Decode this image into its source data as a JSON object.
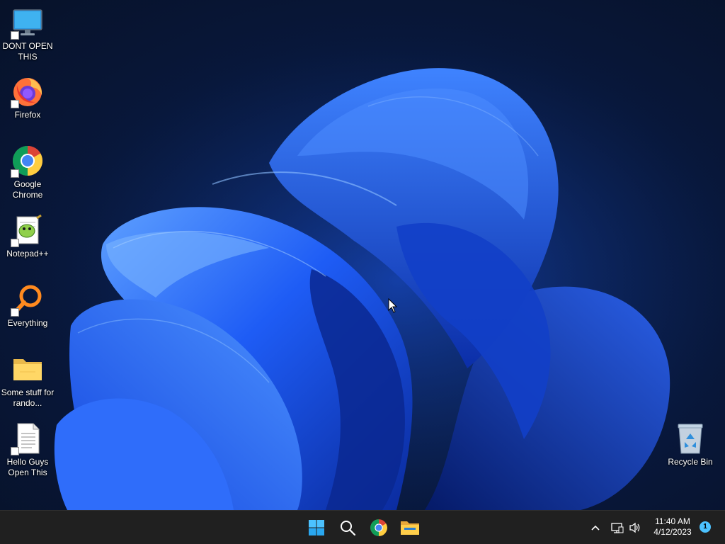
{
  "desktop": {
    "icons": [
      {
        "label": "DONT OPEN THIS",
        "icon": "monitor-icon"
      },
      {
        "label": "Firefox",
        "icon": "firefox-icon"
      },
      {
        "label": "Google Chrome",
        "icon": "chrome-icon"
      },
      {
        "label": "Notepad++",
        "icon": "notepadpp-icon"
      },
      {
        "label": "Everything",
        "icon": "search-everything-icon"
      },
      {
        "label": "Some stuff for rando...",
        "icon": "folder-icon"
      },
      {
        "label": "Hello Guys Open This",
        "icon": "text-file-icon"
      },
      {
        "label": "Recycle Bin",
        "icon": "recycle-bin-icon"
      }
    ]
  },
  "taskbar": {
    "pinned": [
      {
        "name": "Start",
        "icon": "windows-start-icon"
      },
      {
        "name": "Search",
        "icon": "search-icon"
      },
      {
        "name": "Google Chrome",
        "icon": "chrome-icon"
      },
      {
        "name": "File Explorer",
        "icon": "file-explorer-icon"
      }
    ],
    "tray": {
      "overflow_icon": "chevron-up-icon",
      "network_icon": "network-icon",
      "volume_icon": "volume-icon"
    },
    "clock": {
      "time": "11:40 AM",
      "date": "4/12/2023"
    },
    "notification_count": "1"
  },
  "colors": {
    "taskbar_bg": "#202020",
    "wallpaper_accent": "#1a5cff",
    "notification_badge": "#4cc2ff"
  }
}
